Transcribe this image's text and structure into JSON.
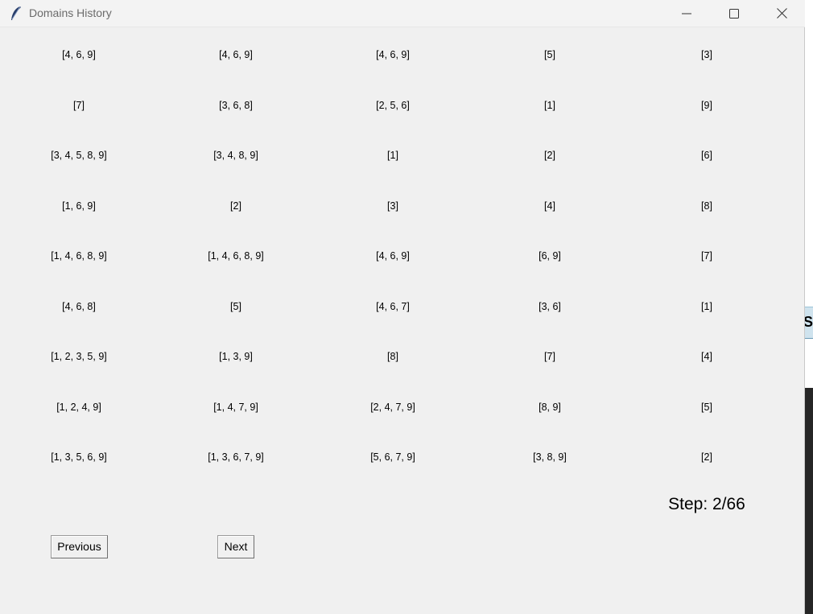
{
  "window": {
    "title": "Domains History",
    "icons": [
      "feather-icon",
      "minimize-icon",
      "maximize-icon",
      "close-icon"
    ]
  },
  "grid": {
    "rows": [
      [
        "[4, 6, 9]",
        "[4, 6, 9]",
        "[4, 6, 9]",
        "[5]",
        "[3]"
      ],
      [
        "[7]",
        "[3, 6, 8]",
        "[2, 5, 6]",
        "[1]",
        "[9]"
      ],
      [
        "[3, 4, 5, 8, 9]",
        "[3, 4, 8, 9]",
        "[1]",
        "[2]",
        "[6]"
      ],
      [
        "[1, 6, 9]",
        "[2]",
        "[3]",
        "[4]",
        "[8]"
      ],
      [
        "[1, 4, 6, 8, 9]",
        "[1, 4, 6, 8, 9]",
        "[4, 6, 9]",
        "[6, 9]",
        "[7]"
      ],
      [
        "[4, 6, 8]",
        "[5]",
        "[4, 6, 7]",
        "[3, 6]",
        "[1]"
      ],
      [
        "[1, 2, 3, 5, 9]",
        "[1, 3, 9]",
        "[8]",
        "[7]",
        "[4]"
      ],
      [
        "[1, 2, 4, 9]",
        "[1, 4, 7, 9]",
        "[2, 4, 7, 9]",
        "[8, 9]",
        "[5]"
      ],
      [
        "[1, 3, 5, 6, 9]",
        "[1, 3, 6, 7, 9]",
        "[5, 6, 7, 9]",
        "[3, 8, 9]",
        "[2]"
      ]
    ]
  },
  "step": {
    "label": "Step: 2/66"
  },
  "buttons": {
    "previous": "Previous",
    "next": "Next"
  },
  "background_window": {
    "partial_text": "Se"
  },
  "colors": {
    "window_bg": "#f0f0f0",
    "title_text": "#6b6b6b"
  }
}
